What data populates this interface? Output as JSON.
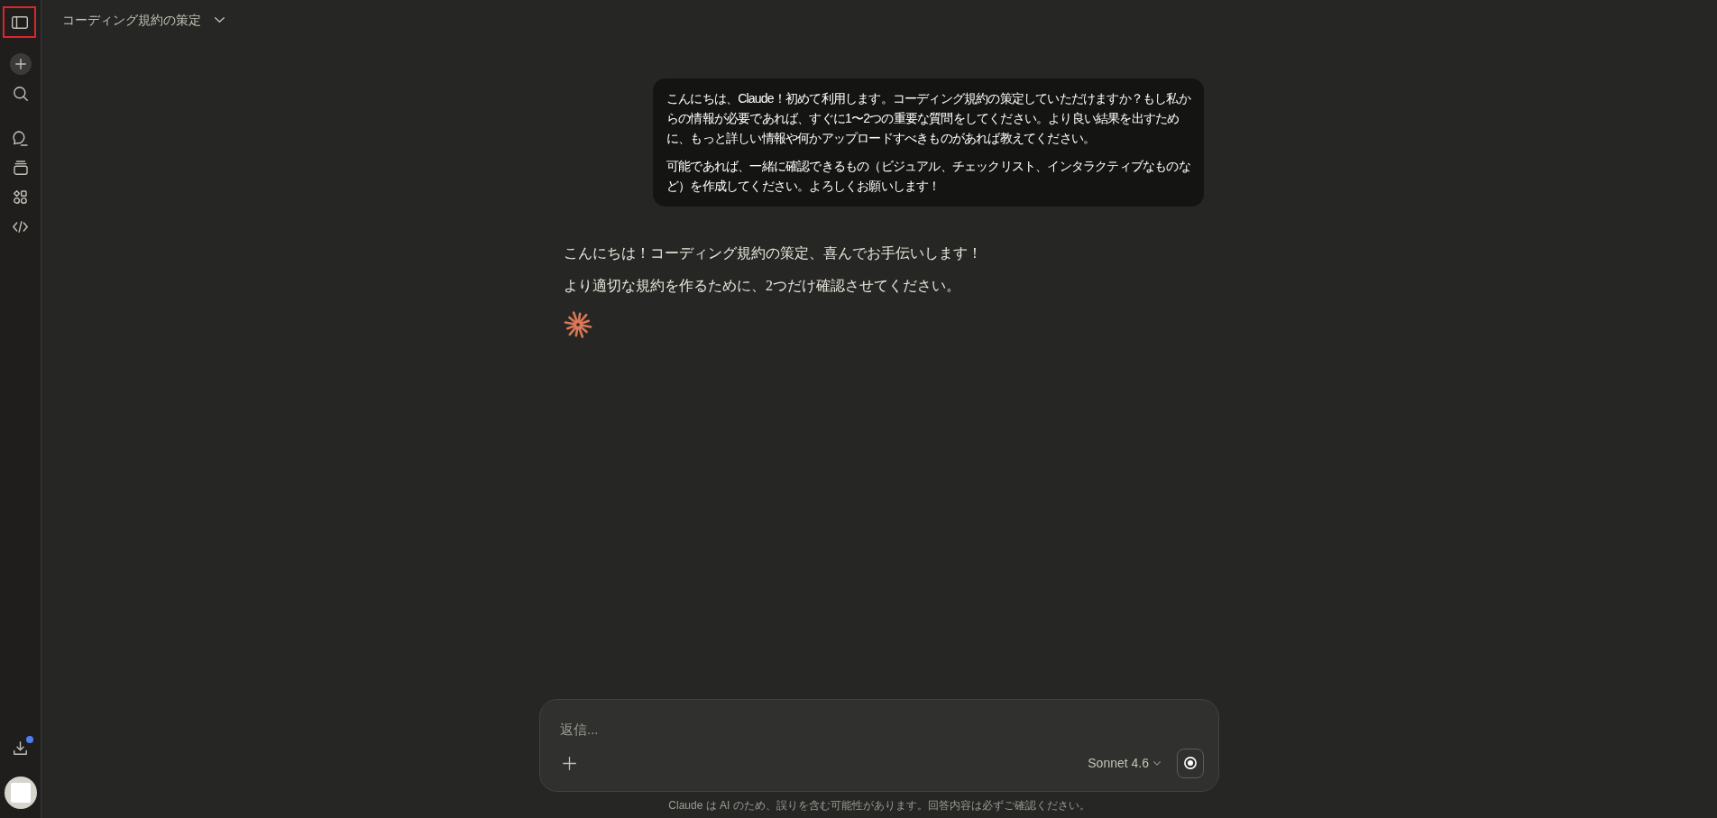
{
  "sidebar": {
    "toggle_highlighted": true,
    "download_badge": true
  },
  "header": {
    "title": "コーディング規約の策定"
  },
  "messages": [
    {
      "kind": "prompt",
      "paragraphs": [
        "こんにちは、Claude！初めて利用します。コーディング規約の策定していただけますか？もし私からの情報が必要であれば、すぐに1〜2つの重要な質問をしてください。より良い結果を出すために、もっと詳しい情報や何かアップロードすべきものがあれば教えてください。",
        "可能であれば、一緒に確認できるもの（ビジュアル、チェックリスト、インタラクティブなものなど）を作成してください。よろしくお願いします！"
      ]
    },
    {
      "kind": "reply",
      "paragraphs": [
        "こんにちは！コーディング規約の策定、喜んでお手伝いします！",
        "より適切な規約を作るために、2つだけ確認させてください。"
      ],
      "streaming": true
    }
  ],
  "composer": {
    "placeholder": "返信...",
    "model": "Sonnet 4.6"
  },
  "disclaimer": "Claude は AI のため、誤りを含む可能性があります。回答内容は必ずご確認ください。"
}
